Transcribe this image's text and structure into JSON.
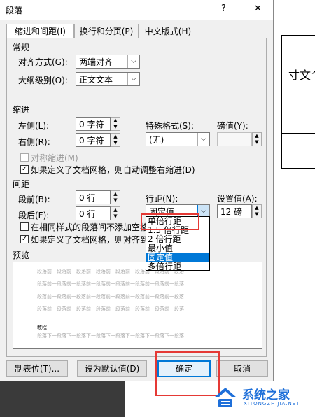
{
  "window": {
    "title": "段落",
    "help": "?",
    "close": "✕"
  },
  "tabs": [
    {
      "label": "缩进和间距(I)",
      "active": true
    },
    {
      "label": "换行和分页(P)",
      "active": false
    },
    {
      "label": "中文版式(H)",
      "active": false
    }
  ],
  "general": {
    "section": "常规",
    "alignment_label": "对齐方式(G):",
    "alignment_value": "两端对齐",
    "outline_label": "大纲级别(O):",
    "outline_value": "正文文本"
  },
  "indent": {
    "section": "缩进",
    "left_label": "左侧(L):",
    "left_value": "0 字符",
    "right_label": "右侧(R):",
    "right_value": "0 字符",
    "special_label": "特殊格式(S):",
    "special_value": "(无)",
    "by_label": "磅值(Y):",
    "by_value": "",
    "mirror_label": "对称缩进(M)",
    "auto_adjust_label": "如果定义了文档网格，则自动调整右缩进(D)"
  },
  "spacing": {
    "section": "间距",
    "before_label": "段前(B):",
    "before_value": "0 行",
    "after_label": "段后(F):",
    "after_value": "0 行",
    "line_label": "行距(N):",
    "line_value": "固定值",
    "at_label": "设置值(A):",
    "at_value": "12 磅",
    "no_space_label": "在相同样式的段落间不添加空格",
    "snap_grid_label": "如果定义了文档网格，则对齐到"
  },
  "line_options": [
    "单倍行距",
    "1.5 倍行距",
    "2 倍行距",
    "最小值",
    "固定值",
    "多倍行距"
  ],
  "line_selected_index": 4,
  "preview": {
    "section": "预览",
    "sample_prev": "段落前一段落前一段落前一段落前一段落前一段落前一段落前一段落",
    "sample_current": "教程",
    "sample_next": "段落下一段落下一段落下一段落下一段落下一段落下一段落下一段落"
  },
  "buttons": {
    "tabs_button": "制表位(T)...",
    "default_button": "设为默认值(D)",
    "ok_button": "确定",
    "cancel_button": "取消"
  },
  "doc_text": "寸文^",
  "watermark": {
    "name": "系统之家",
    "url": "XITONGZHIJIA.NET"
  },
  "colors": {
    "highlight": "#e53935",
    "selection": "#0078d7",
    "logo": "#1e6fd9"
  }
}
